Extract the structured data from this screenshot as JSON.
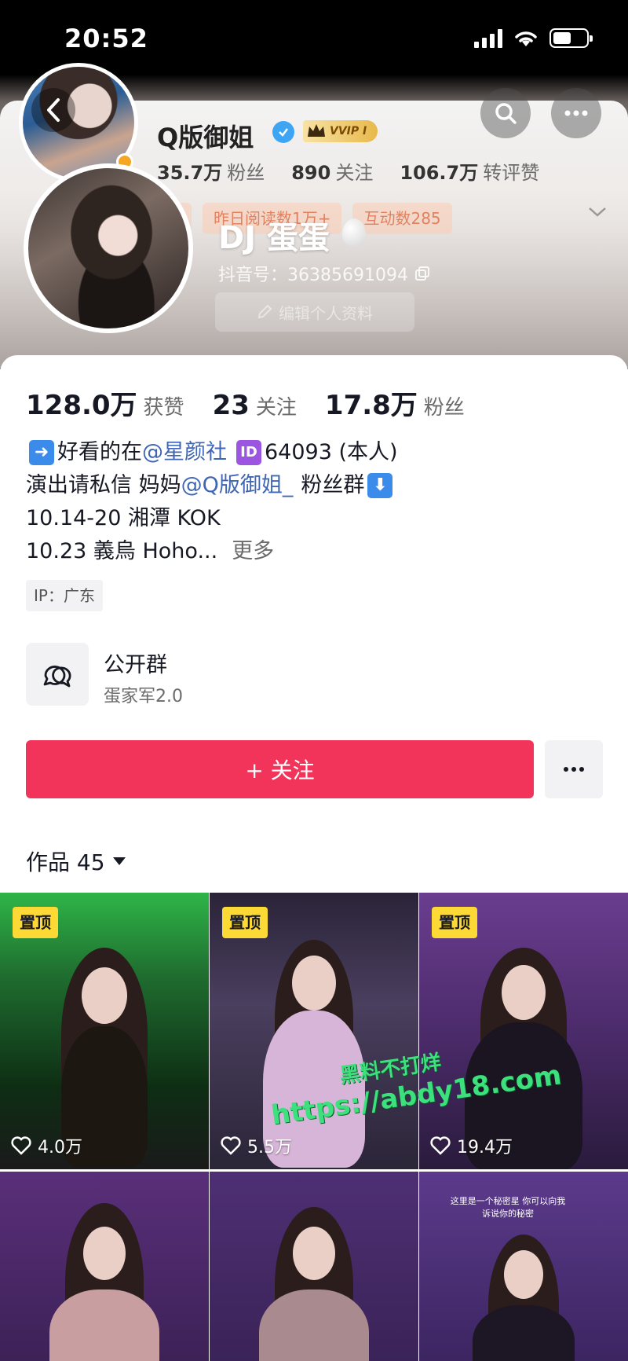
{
  "status_bar": {
    "time": "20:52"
  },
  "mini_header": {
    "name": "Q版御姐",
    "vip_badge": "VVIP I",
    "stats": [
      {
        "value": "35.7万",
        "label": "粉丝"
      },
      {
        "value": "890",
        "label": "关注"
      },
      {
        "value": "106.7万",
        "label": "转评赞"
      }
    ],
    "pills": [
      "分",
      "昨日阅读数1万+",
      "互动数285"
    ]
  },
  "profile": {
    "name": "DJ 蛋蛋",
    "douyin_id": "抖音号：36385691094",
    "edit_button": "编辑个人资料",
    "stats": [
      {
        "value": "128.0万",
        "label": "获赞"
      },
      {
        "value": "23",
        "label": "关注"
      },
      {
        "value": "17.8万",
        "label": "粉丝"
      }
    ],
    "bio": {
      "line1_prefix": "好看的在",
      "line1_link": "@星颜社",
      "line1_suffix": "64093 (本人)",
      "line2_prefix": "演出请私信  妈妈",
      "line2_link": "@Q版御姐_",
      "line2_suffix": "粉丝群",
      "line3": "10.14-20 湘潭 KOK",
      "line4": "10.23 義烏 Hoho...",
      "more": "更多"
    },
    "ip": "IP：广东"
  },
  "group": {
    "title": "公开群",
    "subtitle": "蛋家军2.0"
  },
  "follow_button": "+ 关注",
  "works_tab": "作品 45",
  "videos": [
    {
      "pinned": "置顶",
      "likes": "4.0万"
    },
    {
      "pinned": "置顶",
      "likes": "5.5万"
    },
    {
      "pinned": "置顶",
      "likes": "19.4万"
    },
    {
      "caption": ""
    },
    {
      "caption": ""
    },
    {
      "caption": "这里是一个秘密星 你可以向我诉说你的秘密"
    }
  ],
  "watermark": {
    "line1": "黑料不打烊",
    "line2": "https://abdy18.com"
  },
  "colors": {
    "accent": "#f2345a",
    "link": "#3f66b4",
    "pin": "#fdd935"
  }
}
